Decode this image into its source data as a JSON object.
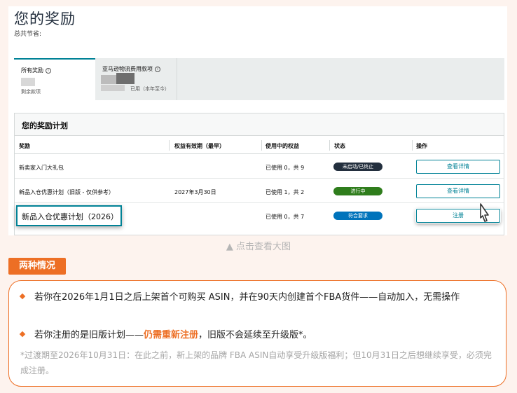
{
  "screenshot": {
    "page_title": "您的奖励",
    "total_savings_label": "总共节省:",
    "tabs": [
      {
        "label": "所有奖励",
        "sub_label": "剩余款项",
        "info_icon": "info-icon"
      },
      {
        "label": "亚马逊物流费用款项",
        "sub_label": "已用（本年至今）",
        "info_icon": "info-icon"
      }
    ],
    "plan_section": {
      "title": "您的奖励计划",
      "columns": [
        "奖励",
        "权益有效期（最早）",
        "使用中的权益",
        "状态",
        "操作"
      ],
      "rows": [
        {
          "name": "新卖家入门大礼包",
          "expiry": "",
          "benefits": "已使用 0，共 9",
          "status": "未启动/已终止",
          "status_color": "#232f3e",
          "action": "查看详情"
        },
        {
          "name": "新品入仓优惠计划（旧版 - 仅供参考）",
          "expiry": "2027年3月30日",
          "benefits": "已使用 1，共 2",
          "status": "进行中",
          "status_color": "#2f7d1c",
          "action": "查看详情"
        },
        {
          "name": "新品入仓优惠计划（2026）",
          "expiry": "",
          "benefits": "已使用 0，共 7",
          "status": "符合要求",
          "status_color": "#0073bb",
          "action": "注册"
        }
      ]
    }
  },
  "zoom_hint": "▲ 点击查看大图",
  "section_tag": "两种情况",
  "bullets": {
    "b1": "若你在2026年1月1日之后上架首个可购买 ASIN，并在90天内创建首个FBA货件——自动加入，无需操作",
    "b2_pre": "若你注册的是旧版计划——",
    "b2_hl": "仍需重新注册",
    "b2_post": "，旧版不会延续至升级版*。"
  },
  "footnote": "*过渡期至2026年10月31日：在此之前，新上架的品牌 FBA ASIN自动享受升级版福利；但10月31日之后想继续享受，必须完成注册。",
  "colors": {
    "accent": "#ed6f25",
    "teal": "#008296"
  }
}
